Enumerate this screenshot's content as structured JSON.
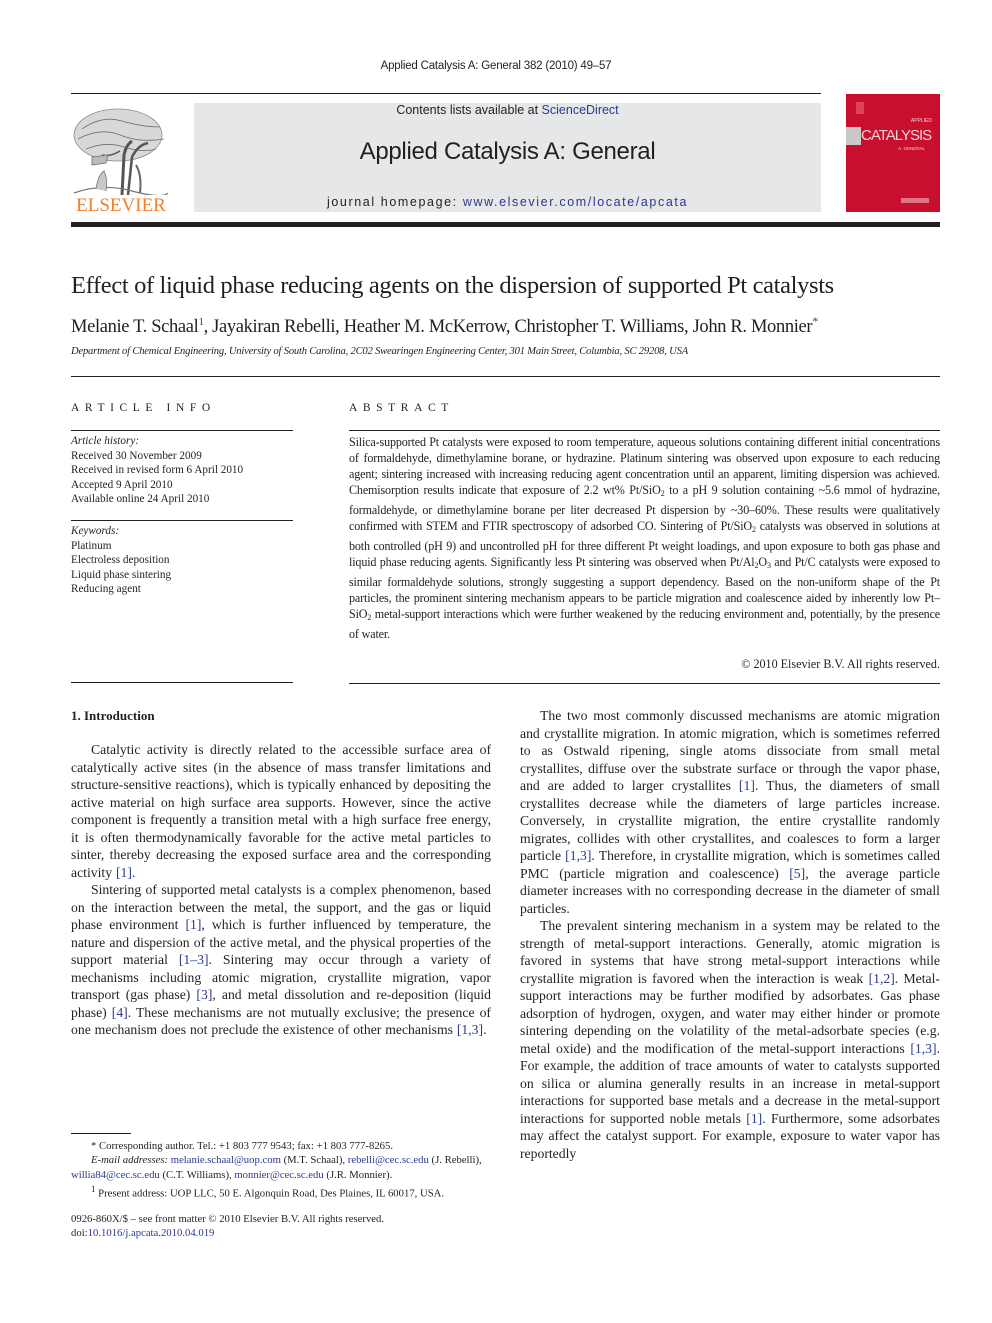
{
  "header": {
    "citation": "Applied Catalysis A: General 382 (2010) 49–57",
    "contents_prefix": "Contents lists available at ",
    "contents_link": "ScienceDirect",
    "journal_title": "Applied Catalysis A: General",
    "homepage_prefix": "journal homepage: ",
    "homepage_link": "www.elsevier.com/locate/apcata",
    "publisher_logo_text": "ELSEVIER",
    "cover": {
      "applied": "APPLIED",
      "catalysis": "CATALYSIS",
      "general": "A: GENERAL",
      "color": "#c8102e"
    },
    "brand_color": "#f0802c",
    "link_color": "#2b3990"
  },
  "article": {
    "title": "Effect of liquid phase reducing agents on the dispersion of supported Pt catalysts",
    "authors": [
      {
        "name": "Melanie T. Schaal",
        "mark": "1"
      },
      {
        "name": "Jayakiran Rebelli",
        "mark": ""
      },
      {
        "name": "Heather M. McKerrow",
        "mark": ""
      },
      {
        "name": "Christopher T. Williams",
        "mark": ""
      },
      {
        "name": "John R. Monnier",
        "mark": "*"
      }
    ],
    "affiliation": "Department of Chemical Engineering, University of South Carolina, 2C02 Swearingen Engineering Center, 301 Main Street, Columbia, SC 29208, USA"
  },
  "article_info": {
    "heading": "ARTICLE INFO",
    "history_label": "Article history:",
    "history": [
      "Received 30 November 2009",
      "Received in revised form 6 April 2010",
      "Accepted 9 April 2010",
      "Available online 24 April 2010"
    ],
    "keywords_label": "Keywords:",
    "keywords": [
      "Platinum",
      "Electroless deposition",
      "Liquid phase sintering",
      "Reducing agent"
    ]
  },
  "abstract": {
    "heading": "ABSTRACT",
    "parts": {
      "p1": "Silica-supported Pt catalysts were exposed to room temperature, aqueous solutions containing different initial concentrations of formaldehyde, dimethylamine borane, or hydrazine. Platinum sintering was observed upon exposure to each reducing agent; sintering increased with increasing reducing agent concentration until an apparent, limiting dispersion was achieved. Chemisorption results indicate that exposure of 2.2 wt% Pt/SiO",
      "p2": " to a pH 9 solution containing ~5.6 mmol of hydrazine, formaldehyde, or dimethylamine borane per liter decreased Pt dispersion by ~30–60%. These results were qualitatively confirmed with STEM and FTIR spectroscopy of adsorbed CO. Sintering of Pt/SiO",
      "p3": " catalysts was observed in solutions at both controlled (pH 9) and uncontrolled pH for three different Pt weight loadings, and upon exposure to both gas phase and liquid phase reducing agents. Significantly less Pt sintering was observed when Pt/Al",
      "p4": "O",
      "p5": " and Pt/C catalysts were exposed to similar formaldehyde solutions, strongly suggesting a support dependency. Based on the non-uniform shape of the Pt particles, the prominent sintering mechanism appears to be particle migration and coalescence aided by inherently low Pt–SiO",
      "p6": " metal-support interactions which were further weakened by the reducing environment and, potentially, by the presence of water.",
      "sub2": "2",
      "sub3": "3"
    },
    "copyright": "© 2010 Elsevier B.V. All rights reserved."
  },
  "body": {
    "section_heading": "1.  Introduction",
    "left": {
      "p1_text": "Catalytic activity is directly related to the accessible surface area of catalytically active sites (in the absence of mass transfer limitations and structure-sensitive reactions), which is typically enhanced by depositing the active material on high surface area supports. However, since the active component is frequently a transition metal with a high surface free energy, it is often thermodynamically favorable for the active metal particles to sinter, thereby decreasing the exposed surface area and the corresponding activity ",
      "p1_ref": "[1]",
      "p1_end": ".",
      "p2_a": "Sintering of supported metal catalysts is a complex phenomenon, based on the interaction between the metal, the support, and the gas or liquid phase environment ",
      "p2_ref1": "[1]",
      "p2_b": ", which is further influenced by temperature, the nature and dispersion of the active metal, and the physical properties of the support material ",
      "p2_ref2": "[1–3]",
      "p2_c": ". Sintering may occur through a variety of mechanisms including atomic migration, crystallite migration, vapor transport (gas phase) ",
      "p2_ref3": "[3]",
      "p2_d": ", and metal dissolution and re-deposition (liquid phase) ",
      "p2_ref4": "[4]",
      "p2_e": ". These mechanisms are not mutually exclusive; the presence of one mechanism does not preclude the existence of other mechanisms ",
      "p2_ref5": "[1,3]",
      "p2_f": "."
    },
    "right": {
      "p1_a": "The two most commonly discussed mechanisms are atomic migration and crystallite migration. In atomic migration, which is sometimes referred to as Ostwald ripening, single atoms dissociate from small metal crystallites, diffuse over the substrate surface or through the vapor phase, and are added to larger crystallites ",
      "p1_ref1": "[1]",
      "p1_b": ". Thus, the diameters of small crystallites decrease while the diameters of large particles increase. Conversely, in crystallite migration, the entire crystallite randomly migrates, collides with other crystallites, and coalesces to form a larger particle ",
      "p1_ref2": "[1,3]",
      "p1_c": ". Therefore, in crystallite migration, which is sometimes called PMC (particle migration and coalescence) ",
      "p1_ref3": "[5]",
      "p1_d": ", the average particle diameter increases with no corresponding decrease in the diameter of small particles.",
      "p2_a": "The prevalent sintering mechanism in a system may be related to the strength of metal-support interactions. Generally, atomic migration is favored in systems that have strong metal-support interactions while crystallite migration is favored when the interaction is weak ",
      "p2_ref1": "[1,2]",
      "p2_b": ". Metal-support interactions may be further modified by adsorbates. Gas phase adsorption of hydrogen, oxygen, and water may either hinder or promote sintering depending on the volatility of the metal-adsorbate species (e.g. metal oxide) and the modification of the metal-support interactions ",
      "p2_ref2": "[1,3]",
      "p2_c": ". For example, the addition of trace amounts of water to catalysts supported on silica or alumina generally results in an increase in metal-support interactions for supported base metals and a decrease in the metal-support interactions for supported noble metals ",
      "p2_ref3": "[1]",
      "p2_d": ". Furthermore, some adsorbates may affect the catalyst support. For example, exposure to water vapor has reportedly"
    }
  },
  "footnotes": {
    "corr_mark": "*",
    "corr_text": "Corresponding author. Tel.: +1 803 777 9543; fax: +1 803 777-8265.",
    "email_label": "E-mail addresses:",
    "emails": [
      {
        "address": "melanie.schaal@uop.com",
        "who": "(M.T. Schaal),"
      },
      {
        "address": "rebelli@cec.sc.edu",
        "who": "(J. Rebelli),"
      },
      {
        "address": "willia84@cec.sc.edu",
        "who": "(C.T. Williams),"
      },
      {
        "address": "monnier@cec.sc.edu",
        "who": "(J.R. Monnier)."
      }
    ],
    "present_mark": "1",
    "present_text": "Present address: UOP LLC, 50 E. Algonquin Road, Des Plaines, IL 60017, USA.",
    "front_matter": "0926-860X/$ – see front matter © 2010 Elsevier B.V. All rights reserved.",
    "doi_prefix": "doi:",
    "doi_link": "10.1016/j.apcata.2010.04.019"
  }
}
